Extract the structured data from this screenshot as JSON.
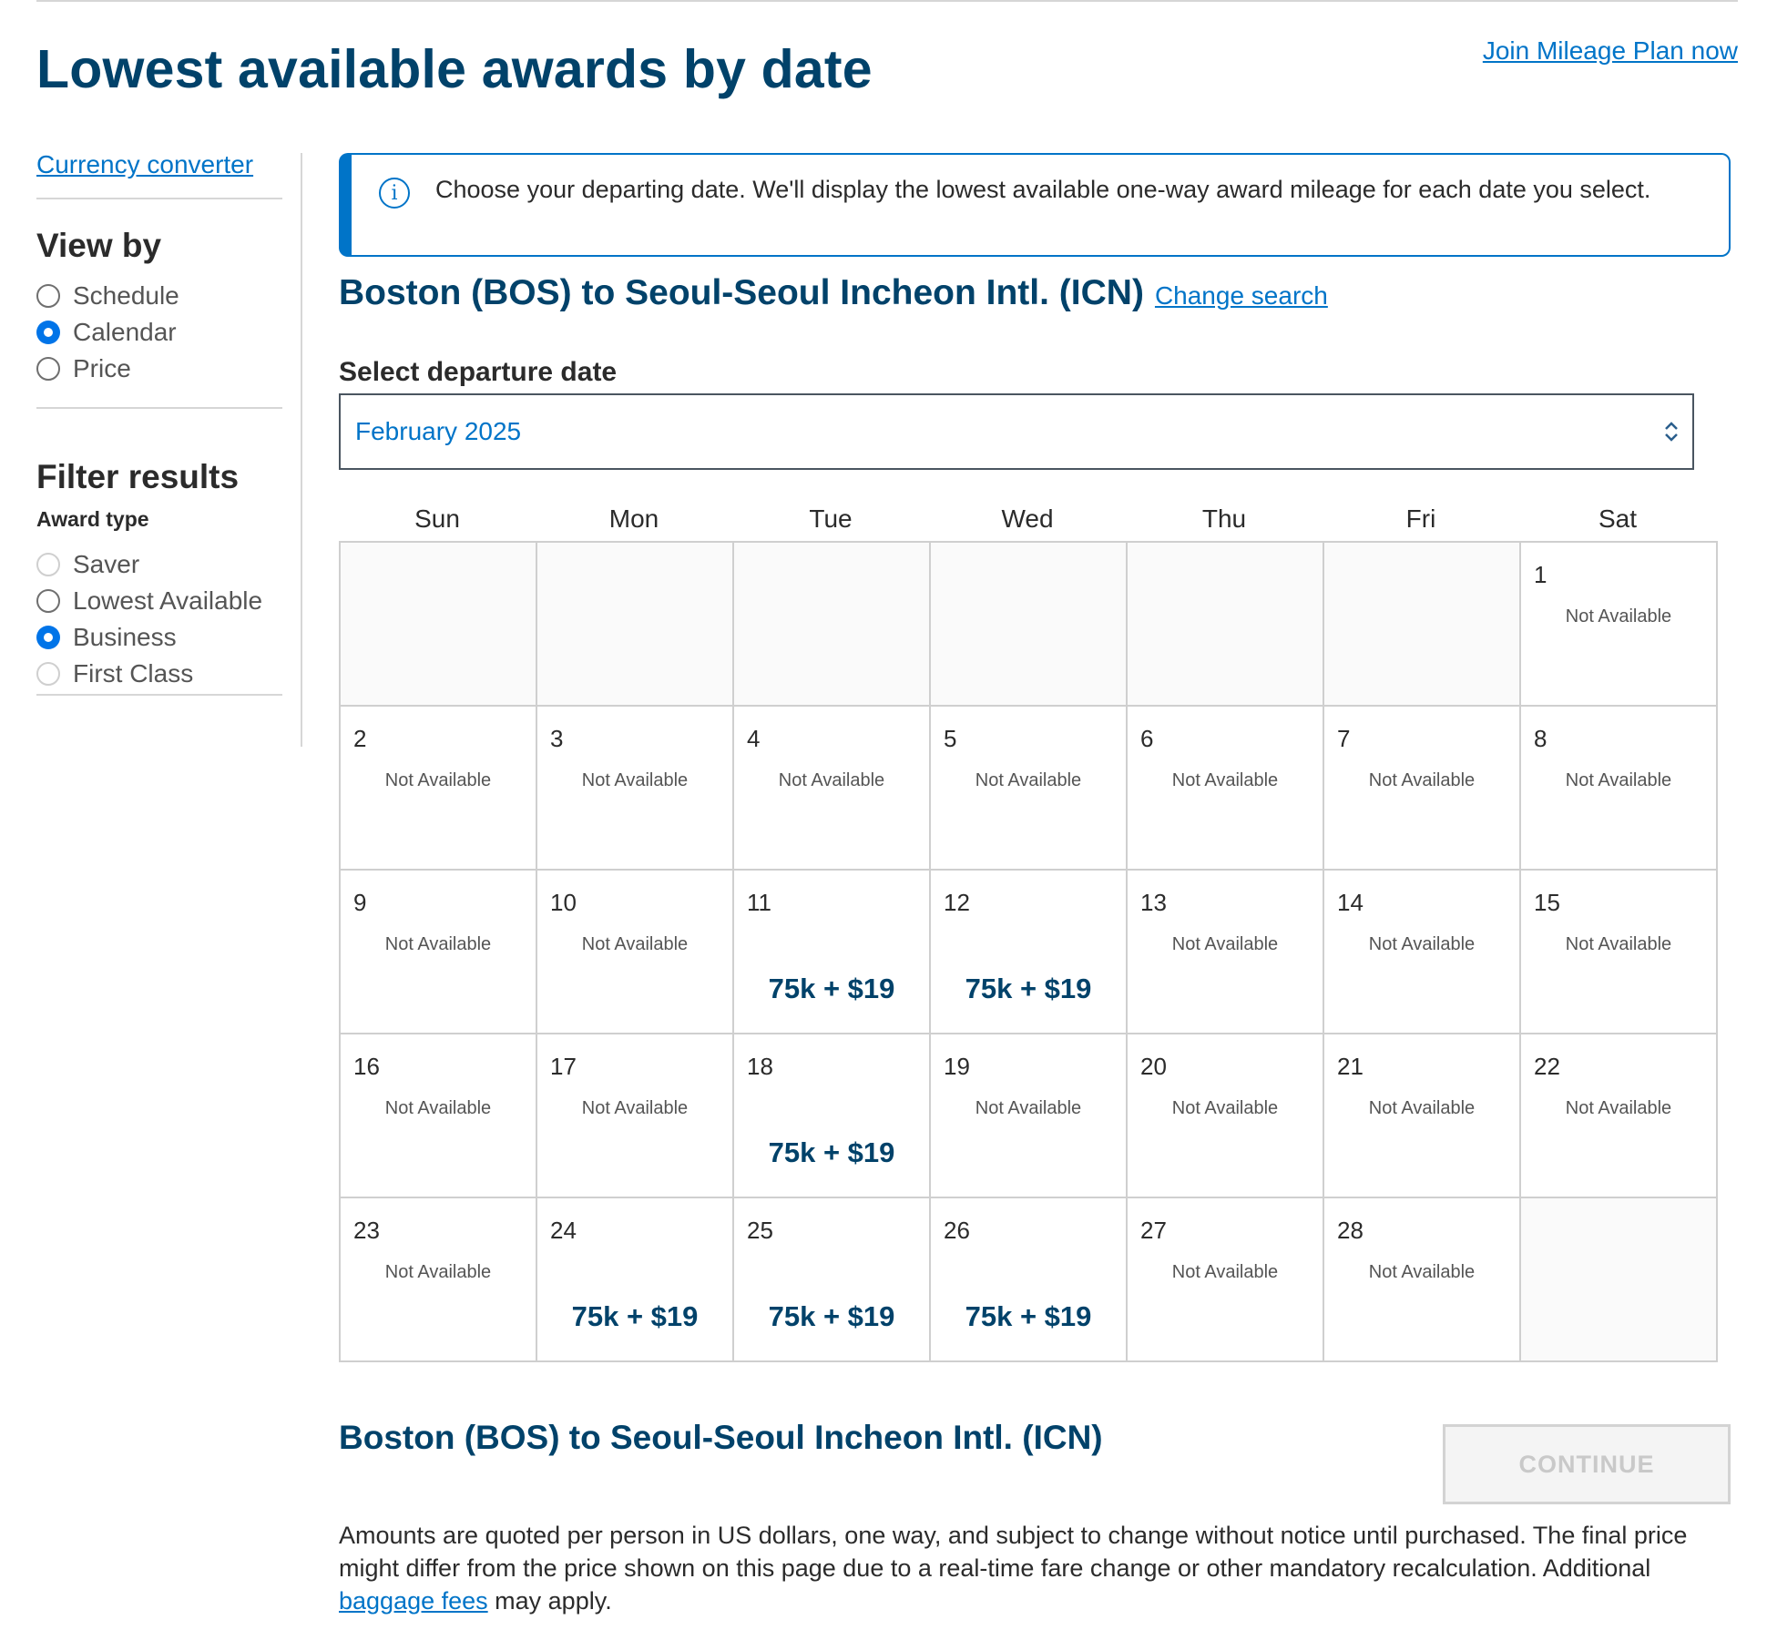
{
  "header": {
    "title": "Lowest available awards by date",
    "join_link": "Join Mileage Plan now"
  },
  "sidebar": {
    "currency_link": "Currency converter",
    "view_by": {
      "heading": "View by",
      "options": [
        {
          "label": "Schedule",
          "selected": false
        },
        {
          "label": "Calendar",
          "selected": true
        },
        {
          "label": "Price",
          "selected": false
        }
      ]
    },
    "filter": {
      "heading": "Filter results",
      "award_type_label": "Award type",
      "options": [
        {
          "label": "Saver",
          "selected": false
        },
        {
          "label": "Lowest Available",
          "selected": false
        },
        {
          "label": "Business",
          "selected": true
        },
        {
          "label": "First Class",
          "selected": false
        }
      ]
    }
  },
  "info": {
    "icon": "info-icon",
    "text": "Choose your departing date. We'll display the lowest available one-way award mileage for each date you select."
  },
  "route": {
    "title": "Boston (BOS) to Seoul-Seoul Incheon Intl. (ICN)",
    "change_link": "Change search"
  },
  "date_select": {
    "label": "Select departure date",
    "value": "February 2025"
  },
  "calendar": {
    "weekdays": [
      "Sun",
      "Mon",
      "Tue",
      "Wed",
      "Thu",
      "Fri",
      "Sat"
    ],
    "leading_blanks": 6,
    "trailing_blanks": 1,
    "days": [
      {
        "day": "1",
        "status": "Not Available"
      },
      {
        "day": "2",
        "status": "Not Available"
      },
      {
        "day": "3",
        "status": "Not Available"
      },
      {
        "day": "4",
        "status": "Not Available"
      },
      {
        "day": "5",
        "status": "Not Available"
      },
      {
        "day": "6",
        "status": "Not Available"
      },
      {
        "day": "7",
        "status": "Not Available"
      },
      {
        "day": "8",
        "status": "Not Available"
      },
      {
        "day": "9",
        "status": "Not Available"
      },
      {
        "day": "10",
        "status": "Not Available"
      },
      {
        "day": "11",
        "price": "75k + $19"
      },
      {
        "day": "12",
        "price": "75k + $19"
      },
      {
        "day": "13",
        "status": "Not Available"
      },
      {
        "day": "14",
        "status": "Not Available"
      },
      {
        "day": "15",
        "status": "Not Available"
      },
      {
        "day": "16",
        "status": "Not Available"
      },
      {
        "day": "17",
        "status": "Not Available"
      },
      {
        "day": "18",
        "price": "75k + $19"
      },
      {
        "day": "19",
        "status": "Not Available"
      },
      {
        "day": "20",
        "status": "Not Available"
      },
      {
        "day": "21",
        "status": "Not Available"
      },
      {
        "day": "22",
        "status": "Not Available"
      },
      {
        "day": "23",
        "status": "Not Available"
      },
      {
        "day": "24",
        "price": "75k + $19"
      },
      {
        "day": "25",
        "price": "75k + $19"
      },
      {
        "day": "26",
        "price": "75k + $19"
      },
      {
        "day": "27",
        "status": "Not Available"
      },
      {
        "day": "28",
        "status": "Not Available"
      }
    ]
  },
  "summary": {
    "route": "Boston (BOS) to Seoul-Seoul Incheon Intl. (ICN)",
    "continue_label": "CONTINUE"
  },
  "disclaimer": {
    "text_before": "Amounts are quoted per person in US dollars, one way, and subject to change without notice until purchased. The final price might differ from the price shown on this page due to a real-time fare change or other mandatory recalculation. Additional ",
    "link": "baggage fees",
    "text_after": " may apply."
  }
}
